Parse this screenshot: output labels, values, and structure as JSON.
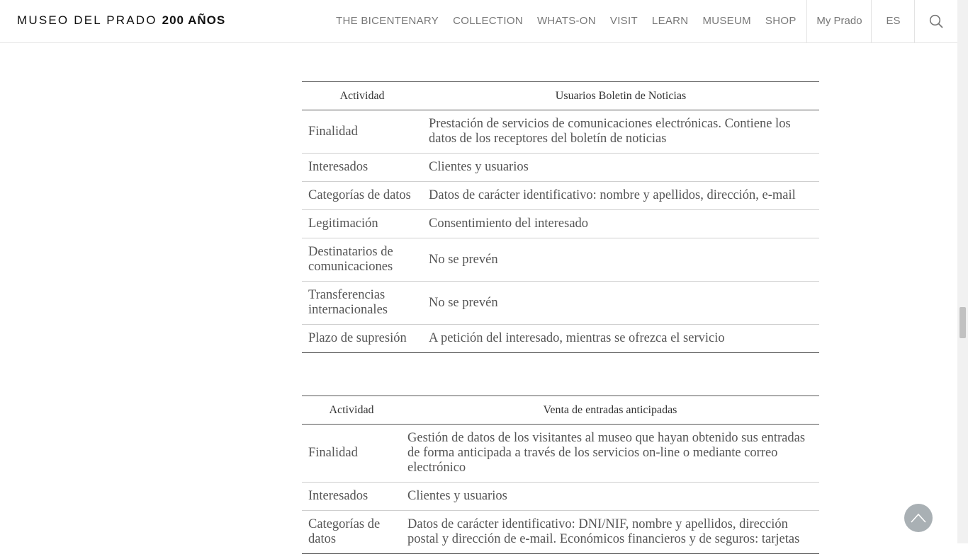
{
  "header": {
    "logo_text": "MUSEO DEL PRADO",
    "logo_bold": "200 AÑOS",
    "nav": [
      "THE BICENTENARY",
      "COLLECTION",
      "WHATS-ON",
      "VISIT",
      "LEARN",
      "MUSEUM",
      "SHOP"
    ],
    "my_prado": "My Prado",
    "language": "ES",
    "search_icon": "search-icon"
  },
  "table1": {
    "headers": [
      "Actividad",
      "Usuarios Boletin de Noticias"
    ],
    "rows": [
      [
        "Finalidad",
        "Prestación de servicios de comunicaciones electrónicas. Contiene los datos de los receptores del boletín de noticias"
      ],
      [
        "Interesados",
        "Clientes y usuarios"
      ],
      [
        "Categorías de datos",
        "Datos de carácter identificativo: nombre y apellidos, dirección, e-mail"
      ],
      [
        "Legitimación",
        "Consentimiento del interesado"
      ],
      [
        "Destinatarios de comunicaciones",
        "No se prevén"
      ],
      [
        "Transferencias internacionales",
        "No se prevén"
      ],
      [
        "Plazo de supresión",
        "A petición del interesado, mientras se ofrezca el servicio"
      ]
    ]
  },
  "table2": {
    "headers": [
      "Actividad",
      "Venta de entradas anticipadas"
    ],
    "rows": [
      [
        "Finalidad",
        "Gestión de datos de los visitantes al museo que hayan obtenido sus entradas de forma anticipada a través de los servicios on-line o mediante correo electrónico"
      ],
      [
        "Interesados",
        "Clientes y usuarios"
      ],
      [
        "Categorías de datos",
        "Datos de carácter identificativo: DNI/NIF, nombre y apellidos, dirección postal y dirección de e-mail. Económicos financieros y de seguros: tarjetas"
      ]
    ]
  },
  "back_to_top_icon": "chevron-up-icon"
}
